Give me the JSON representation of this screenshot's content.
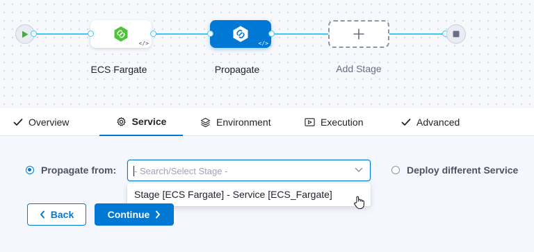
{
  "pipeline": {
    "stages": [
      {
        "label": "ECS Fargate",
        "icon": "ecs-fargate-icon",
        "badge": "</>"
      },
      {
        "label": "Propagate",
        "icon": "propagate-icon",
        "badge": "</>"
      },
      {
        "label": "Add Stage",
        "icon": "plus-icon"
      }
    ],
    "accent": "#3dc7f6",
    "brand": "#0278d5"
  },
  "tabs": [
    {
      "label": "Overview",
      "icon": "check-icon"
    },
    {
      "label": "Service",
      "icon": "gear-icon",
      "active": true
    },
    {
      "label": "Environment",
      "icon": "environment-icon"
    },
    {
      "label": "Execution",
      "icon": "execution-icon"
    },
    {
      "label": "Advanced",
      "icon": "check-icon"
    }
  ],
  "service": {
    "propagate_label": "Propagate from:",
    "select_placeholder": "- Search/Select Stage -",
    "option": "Stage [ECS Fargate] - Service [ECS_Fargate]",
    "deploy_different_label": "Deploy different Service"
  },
  "footer": {
    "back_label": "Back",
    "continue_label": "Continue"
  }
}
